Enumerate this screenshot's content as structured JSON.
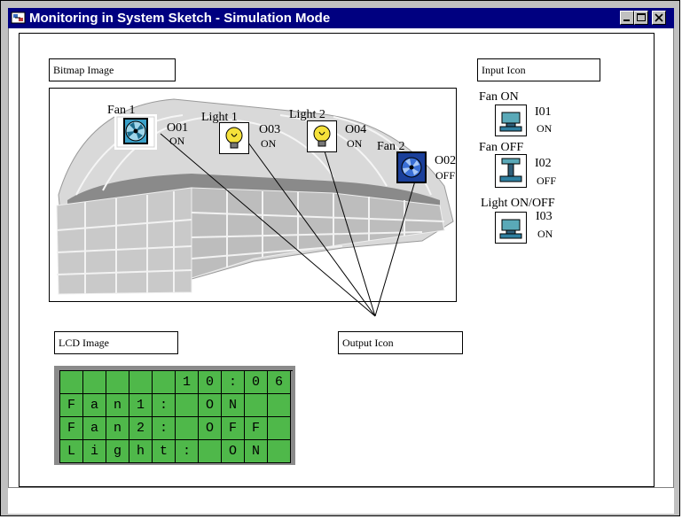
{
  "window": {
    "title": "Monitoring in System Sketch - Simulation Mode"
  },
  "labels": {
    "bitmap": "Bitmap Image",
    "input_icon": "Input Icon",
    "lcd_image": "LCD Image",
    "output_icon": "Output Icon"
  },
  "outputs": [
    {
      "name": "Fan 1",
      "id": "O01",
      "state": "ON",
      "icon": "fan-icon"
    },
    {
      "name": "Light 1",
      "id": "O03",
      "state": "ON",
      "icon": "light-bulb-icon"
    },
    {
      "name": "Light 2",
      "id": "O04",
      "state": "ON",
      "icon": "light-bulb-icon"
    },
    {
      "name": "Fan 2",
      "id": "O02",
      "state": "OFF",
      "icon": "fan-icon"
    }
  ],
  "inputs": [
    {
      "name": "Fan ON",
      "id": "I01",
      "state": "ON",
      "icon": "push-button-icon"
    },
    {
      "name": "Fan OFF",
      "id": "I02",
      "state": "OFF",
      "icon": "push-button-icon"
    },
    {
      "name": "Light ON/OFF",
      "id": "I03",
      "state": "ON",
      "icon": "push-button-icon"
    }
  ],
  "lcd": {
    "rows": [
      [
        "",
        "",
        "",
        "",
        "",
        "1",
        "0",
        ":",
        "0",
        "6"
      ],
      [
        "F",
        "a",
        "n",
        "1",
        ":",
        "",
        "O",
        "N",
        "",
        ""
      ],
      [
        "F",
        "a",
        "n",
        "2",
        ":",
        "",
        "O",
        "F",
        "F",
        ""
      ],
      [
        "L",
        "i",
        "g",
        "h",
        "t",
        ":",
        "",
        "O",
        "N",
        ""
      ]
    ]
  },
  "colors": {
    "titlebar": "#000080",
    "lcd_cell": "#4fb84a",
    "lcd_bezel": "#8a8a8a",
    "fan_on": "#3aa0c8",
    "fan_off": "#1a3f9a",
    "bulb": "#f5e13a"
  }
}
